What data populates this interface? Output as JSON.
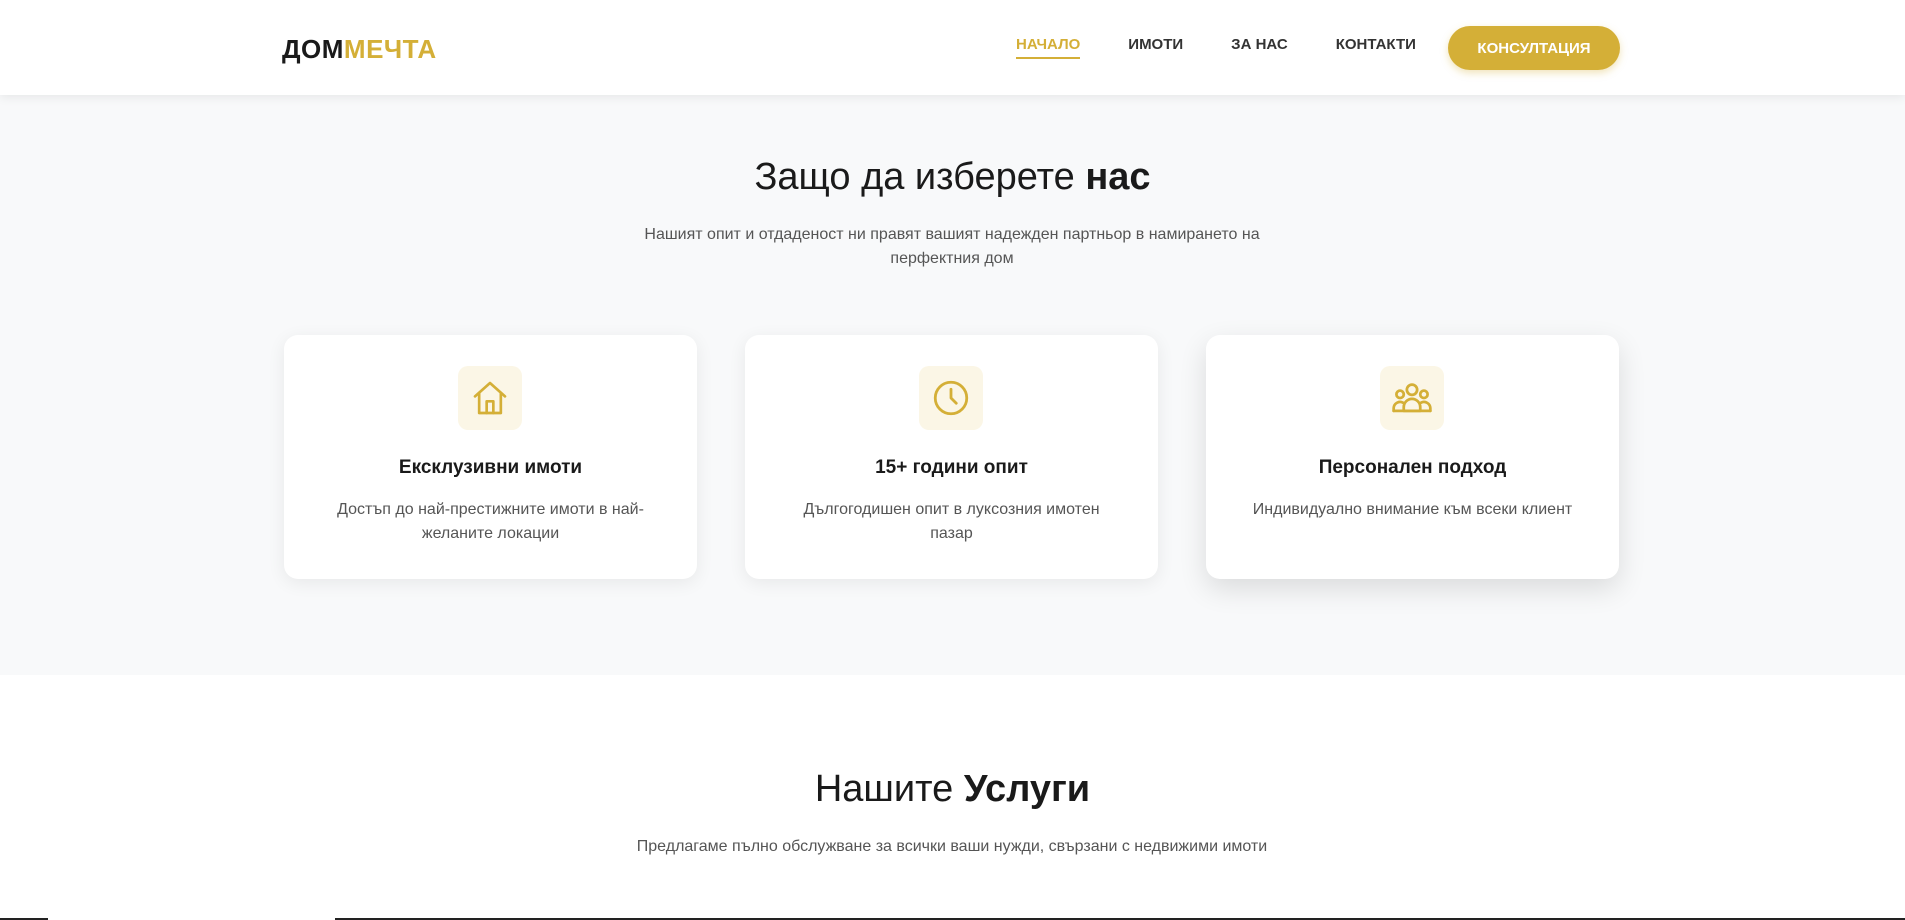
{
  "header": {
    "logo_part1": "ДОМ",
    "logo_part2": "МЕЧТА",
    "nav": [
      "НАЧАЛО",
      "ИМОТИ",
      "ЗА НАС",
      "КОНТАКТИ"
    ],
    "cta_label": "КОНСУЛТАЦИЯ"
  },
  "why": {
    "title_regular": "Защо да изберете",
    "title_bold": "нас",
    "subtitle": "Нашият опит и отдаденост ни правят вашият надежден партньор в намирането на перфектния дом",
    "cards": [
      {
        "icon": "house-icon",
        "title": "Ексклузивни имоти",
        "text": "Достъп до най-престижните имоти в най-желаните локации"
      },
      {
        "icon": "clock-icon",
        "title": "15+ години опит",
        "text": "Дългогодишен опит в луксозния имотен пазар"
      },
      {
        "icon": "users-icon",
        "title": "Персонален подход",
        "text": "Индивидуално внимание към всеки клиент"
      }
    ]
  },
  "services": {
    "title_regular": "Нашите",
    "title_bold": "Услуги",
    "subtitle": "Предлагаме пълно обслужване за всички ваши нужди, свързани с недвижими имоти"
  },
  "colors": {
    "accent": "#d4af37",
    "section_bg": "#f8f9fa",
    "icon_bg": "#fbf6e6"
  }
}
